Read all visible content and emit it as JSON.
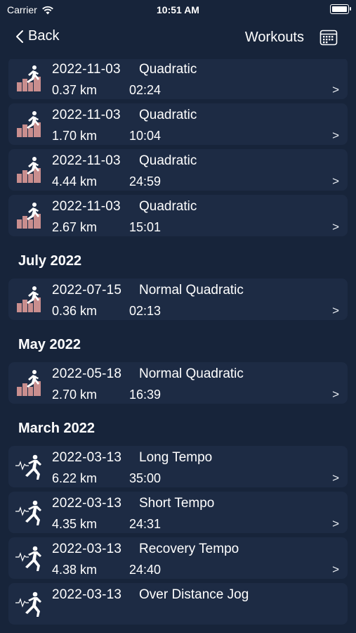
{
  "status_bar": {
    "carrier": "Carrier",
    "time": "10:51 AM"
  },
  "nav": {
    "back_label": "Back",
    "title": "Workouts"
  },
  "sections": [
    {
      "header": "",
      "rows": [
        {
          "icon": "runner-stairs-icon",
          "date": "2022-11-03",
          "name": "Quadratic",
          "distance": "0.37 km",
          "duration": "02:24"
        },
        {
          "icon": "runner-stairs-icon",
          "date": "2022-11-03",
          "name": "Quadratic",
          "distance": "1.70 km",
          "duration": "10:04"
        },
        {
          "icon": "runner-stairs-icon",
          "date": "2022-11-03",
          "name": "Quadratic",
          "distance": "4.44 km",
          "duration": "24:59"
        },
        {
          "icon": "runner-stairs-icon",
          "date": "2022-11-03",
          "name": "Quadratic",
          "distance": "2.67 km",
          "duration": "15:01"
        }
      ]
    },
    {
      "header": "July 2022",
      "rows": [
        {
          "icon": "runner-stairs-icon",
          "date": "2022-07-15",
          "name": "Normal Quadratic",
          "distance": "0.36 km",
          "duration": "02:13"
        }
      ]
    },
    {
      "header": "May 2022",
      "rows": [
        {
          "icon": "runner-stairs-icon",
          "date": "2022-05-18",
          "name": "Normal Quadratic",
          "distance": "2.70 km",
          "duration": "16:39"
        }
      ]
    },
    {
      "header": "March 2022",
      "rows": [
        {
          "icon": "runner-pulse-icon",
          "date": "2022-03-13",
          "name": "Long Tempo",
          "distance": "6.22 km",
          "duration": "35:00"
        },
        {
          "icon": "runner-pulse-icon",
          "date": "2022-03-13",
          "name": "Short Tempo",
          "distance": "4.35 km",
          "duration": "24:31"
        },
        {
          "icon": "runner-pulse-icon",
          "date": "2022-03-13",
          "name": "Recovery Tempo",
          "distance": "4.38 km",
          "duration": "24:40"
        },
        {
          "icon": "runner-pulse-icon",
          "date": "2022-03-13",
          "name": "Over Distance Jog",
          "distance": "",
          "duration": ""
        }
      ]
    }
  ],
  "row_chevron": ">",
  "colors": {
    "background": "#17243a",
    "row": "#1d2b44",
    "stairs": "#c98e8e"
  }
}
